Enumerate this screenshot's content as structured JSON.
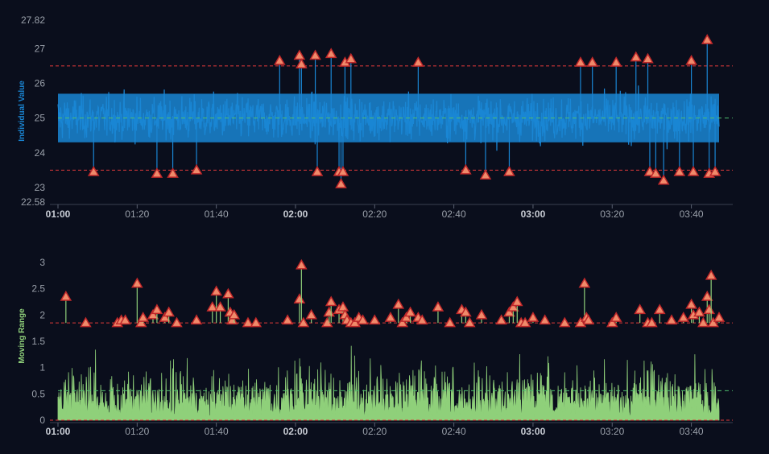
{
  "colors": {
    "background": "#0a0e1c",
    "individual_series": "#1a86d4",
    "moving_range_series": "#8fd07a",
    "limit_line": "#e03a3a",
    "center_line": "#4fbf6f",
    "marker_fill": "#f08a6a",
    "marker_stroke": "#c0282a",
    "tick_text": "#9aa0aa",
    "ylabel_individual": "#1a86d4",
    "ylabel_moving_range": "#8fd07a"
  },
  "chart_data": [
    {
      "type": "line",
      "ylabel": "Individual Value",
      "ylim": [
        22.58,
        27.82
      ],
      "y_ticks": [
        "22.58",
        "23",
        "24",
        "25",
        "26",
        "27",
        "27.82"
      ],
      "x_ticks": [
        "01:00",
        "01:20",
        "01:40",
        "02:00",
        "02:20",
        "02:40",
        "03:00",
        "03:20",
        "03:40"
      ],
      "x_ticks_bold": [
        "01:00",
        "02:00",
        "03:00"
      ],
      "time_range_minutes": [
        0,
        167
      ],
      "center_line": 25.0,
      "ucl": 26.5,
      "lcl": 23.5,
      "typical_band": [
        24.3,
        25.7
      ],
      "signals": [
        {
          "t": 9,
          "y": 23.45
        },
        {
          "t": 25,
          "y": 23.4
        },
        {
          "t": 29,
          "y": 23.4
        },
        {
          "t": 35,
          "y": 23.5
        },
        {
          "t": 56,
          "y": 26.65
        },
        {
          "t": 61,
          "y": 26.8
        },
        {
          "t": 61.5,
          "y": 26.55
        },
        {
          "t": 65,
          "y": 26.8
        },
        {
          "t": 65.5,
          "y": 23.45
        },
        {
          "t": 69,
          "y": 26.85
        },
        {
          "t": 71,
          "y": 23.45
        },
        {
          "t": 71.5,
          "y": 23.1
        },
        {
          "t": 72,
          "y": 23.45
        },
        {
          "t": 72.5,
          "y": 26.6
        },
        {
          "t": 74,
          "y": 26.7
        },
        {
          "t": 91,
          "y": 26.6
        },
        {
          "t": 103,
          "y": 23.5
        },
        {
          "t": 108,
          "y": 23.35
        },
        {
          "t": 114,
          "y": 23.45
        },
        {
          "t": 132,
          "y": 26.6
        },
        {
          "t": 135,
          "y": 26.6
        },
        {
          "t": 141,
          "y": 26.6
        },
        {
          "t": 146,
          "y": 26.75
        },
        {
          "t": 149,
          "y": 26.7
        },
        {
          "t": 149.5,
          "y": 23.45
        },
        {
          "t": 151,
          "y": 23.4
        },
        {
          "t": 153,
          "y": 23.2
        },
        {
          "t": 157,
          "y": 23.45
        },
        {
          "t": 160,
          "y": 26.65
        },
        {
          "t": 160.5,
          "y": 23.45
        },
        {
          "t": 164,
          "y": 27.25
        },
        {
          "t": 164.5,
          "y": 23.4
        },
        {
          "t": 166,
          "y": 23.45
        }
      ]
    },
    {
      "type": "area",
      "ylabel": "Moving Range",
      "ylim": [
        0,
        3.2
      ],
      "y_ticks": [
        "0",
        "0.5",
        "1",
        "1.5",
        "2",
        "2.5",
        "3"
      ],
      "x_ticks": [
        "01:00",
        "01:20",
        "01:40",
        "02:00",
        "02:20",
        "02:40",
        "03:00",
        "03:20",
        "03:40"
      ],
      "x_ticks_bold": [
        "01:00",
        "02:00",
        "03:00"
      ],
      "time_range_minutes": [
        0,
        167
      ],
      "center_line": 0.56,
      "ucl": 1.85,
      "lcl": 0,
      "signals": [
        {
          "t": 2,
          "y": 2.35
        },
        {
          "t": 7,
          "y": 1.85
        },
        {
          "t": 15,
          "y": 1.85
        },
        {
          "t": 16,
          "y": 1.9
        },
        {
          "t": 17,
          "y": 1.9
        },
        {
          "t": 20,
          "y": 2.6
        },
        {
          "t": 21,
          "y": 1.85
        },
        {
          "t": 21.5,
          "y": 1.95
        },
        {
          "t": 24,
          "y": 2.0
        },
        {
          "t": 25,
          "y": 2.1
        },
        {
          "t": 27,
          "y": 1.95
        },
        {
          "t": 28,
          "y": 2.05
        },
        {
          "t": 30,
          "y": 1.85
        },
        {
          "t": 35,
          "y": 1.9
        },
        {
          "t": 39,
          "y": 2.15
        },
        {
          "t": 40,
          "y": 2.45
        },
        {
          "t": 41,
          "y": 2.15
        },
        {
          "t": 43,
          "y": 2.4
        },
        {
          "t": 43.5,
          "y": 2.05
        },
        {
          "t": 44,
          "y": 1.9
        },
        {
          "t": 44.5,
          "y": 2.0
        },
        {
          "t": 48,
          "y": 1.85
        },
        {
          "t": 50,
          "y": 1.85
        },
        {
          "t": 58,
          "y": 1.9
        },
        {
          "t": 61,
          "y": 2.3
        },
        {
          "t": 61.5,
          "y": 2.95
        },
        {
          "t": 62,
          "y": 1.85
        },
        {
          "t": 64,
          "y": 2.0
        },
        {
          "t": 68,
          "y": 1.85
        },
        {
          "t": 68.5,
          "y": 2.05
        },
        {
          "t": 69,
          "y": 2.25
        },
        {
          "t": 71,
          "y": 2.1
        },
        {
          "t": 72,
          "y": 2.15
        },
        {
          "t": 72.5,
          "y": 2.0
        },
        {
          "t": 73,
          "y": 1.9
        },
        {
          "t": 74,
          "y": 1.85
        },
        {
          "t": 75,
          "y": 1.85
        },
        {
          "t": 76,
          "y": 1.95
        },
        {
          "t": 77,
          "y": 1.9
        },
        {
          "t": 80,
          "y": 1.9
        },
        {
          "t": 84,
          "y": 1.95
        },
        {
          "t": 86,
          "y": 2.2
        },
        {
          "t": 87,
          "y": 1.85
        },
        {
          "t": 88,
          "y": 1.95
        },
        {
          "t": 89,
          "y": 2.05
        },
        {
          "t": 91,
          "y": 1.95
        },
        {
          "t": 92,
          "y": 1.9
        },
        {
          "t": 96,
          "y": 2.15
        },
        {
          "t": 99,
          "y": 1.85
        },
        {
          "t": 102,
          "y": 2.1
        },
        {
          "t": 103,
          "y": 2.05
        },
        {
          "t": 104,
          "y": 1.85
        },
        {
          "t": 107,
          "y": 2.0
        },
        {
          "t": 112,
          "y": 1.9
        },
        {
          "t": 114,
          "y": 2.05
        },
        {
          "t": 115,
          "y": 2.15
        },
        {
          "t": 116,
          "y": 2.25
        },
        {
          "t": 117,
          "y": 1.85
        },
        {
          "t": 118,
          "y": 1.85
        },
        {
          "t": 120,
          "y": 1.95
        },
        {
          "t": 123,
          "y": 1.9
        },
        {
          "t": 128,
          "y": 1.85
        },
        {
          "t": 132,
          "y": 1.85
        },
        {
          "t": 133,
          "y": 2.6
        },
        {
          "t": 133.5,
          "y": 1.95
        },
        {
          "t": 134,
          "y": 1.9
        },
        {
          "t": 140,
          "y": 1.85
        },
        {
          "t": 141,
          "y": 1.95
        },
        {
          "t": 147,
          "y": 2.1
        },
        {
          "t": 149,
          "y": 1.85
        },
        {
          "t": 150,
          "y": 1.85
        },
        {
          "t": 152,
          "y": 2.1
        },
        {
          "t": 155,
          "y": 1.9
        },
        {
          "t": 158,
          "y": 1.95
        },
        {
          "t": 160,
          "y": 2.2
        },
        {
          "t": 160.5,
          "y": 2.0
        },
        {
          "t": 162,
          "y": 2.05
        },
        {
          "t": 163,
          "y": 1.85
        },
        {
          "t": 164,
          "y": 2.35
        },
        {
          "t": 164.5,
          "y": 2.1
        },
        {
          "t": 165,
          "y": 2.75
        },
        {
          "t": 165.5,
          "y": 1.85
        },
        {
          "t": 167,
          "y": 1.95
        }
      ]
    }
  ]
}
